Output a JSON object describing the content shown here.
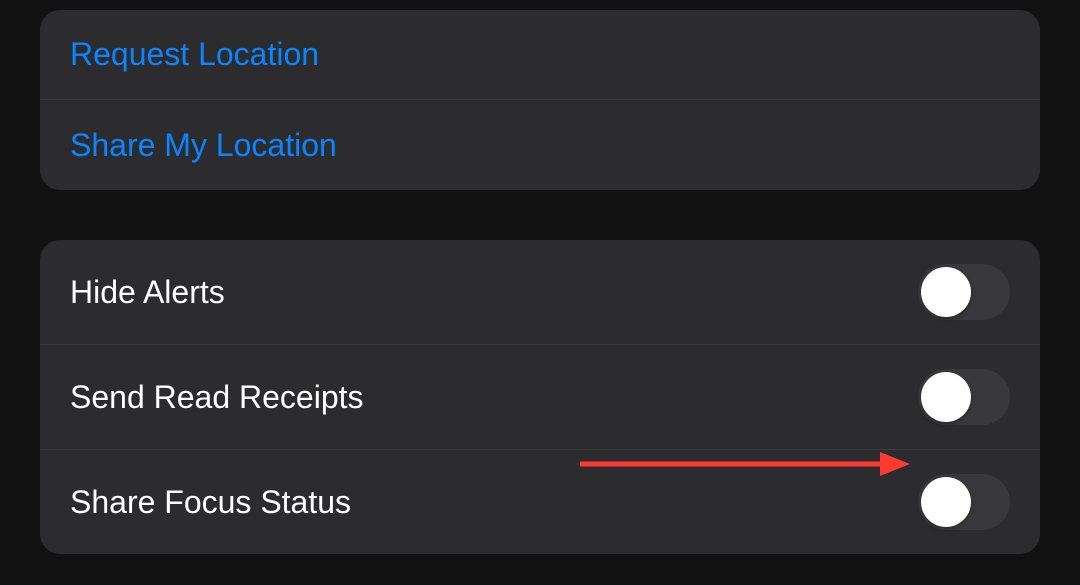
{
  "locationSection": {
    "requestLocation": {
      "label": "Request Location"
    },
    "shareMyLocation": {
      "label": "Share My Location"
    }
  },
  "settingsSection": {
    "hideAlerts": {
      "label": "Hide Alerts",
      "enabled": false
    },
    "sendReadReceipts": {
      "label": "Send Read Receipts",
      "enabled": false
    },
    "shareFocusStatus": {
      "label": "Share Focus Status",
      "enabled": false
    }
  },
  "annotation": {
    "arrowColor": "#ff3b30"
  }
}
